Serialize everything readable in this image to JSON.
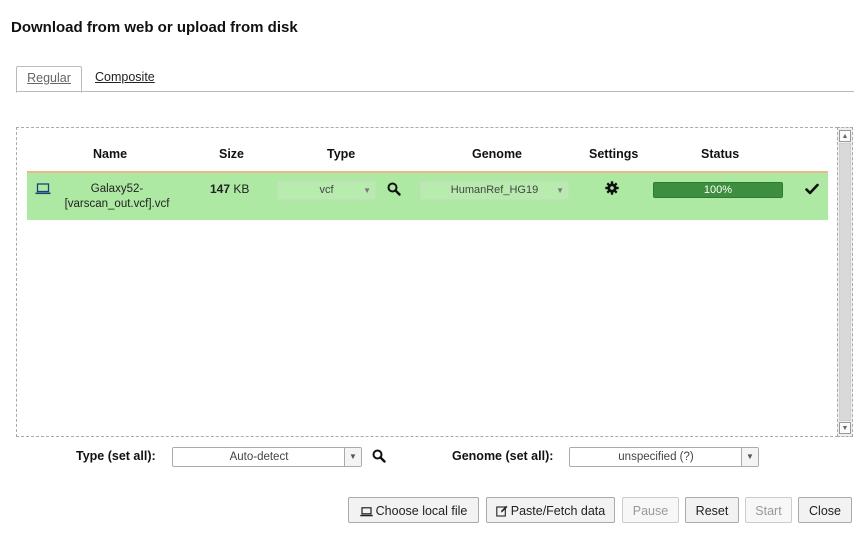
{
  "dialog": {
    "title": "Download from web or upload from disk"
  },
  "tabs": [
    {
      "label": "Regular",
      "active": true
    },
    {
      "label": "Composite",
      "active": false
    }
  ],
  "table": {
    "columns": [
      "Name",
      "Size",
      "Type",
      "Genome",
      "Settings",
      "Status"
    ],
    "rows": [
      {
        "source_icon": "laptop-icon",
        "name_line1": "Galaxy52-",
        "name_line2": "[varscan_out.vcf].vcf",
        "size_value": "147",
        "size_unit": "KB",
        "type": "vcf",
        "genome": "HumanRef_HG19",
        "settings_icon": "gear-icon",
        "progress": "100%",
        "progress_fraction": 1.0,
        "status_icon": "check-icon"
      }
    ]
  },
  "footer": {
    "type_label": "Type (set all):",
    "type_value": "Auto-detect",
    "genome_label": "Genome (set all):",
    "genome_value": "unspecified (?)"
  },
  "buttons": {
    "choose_local": "Choose local file",
    "paste_fetch": "Paste/Fetch data",
    "pause": "Pause",
    "reset": "Reset",
    "start": "Start",
    "close": "Close"
  },
  "colors": {
    "row_success_bg": "#aee9a4",
    "progress_bar": "#3d8e3e",
    "header_separator": "#e8b98a"
  }
}
